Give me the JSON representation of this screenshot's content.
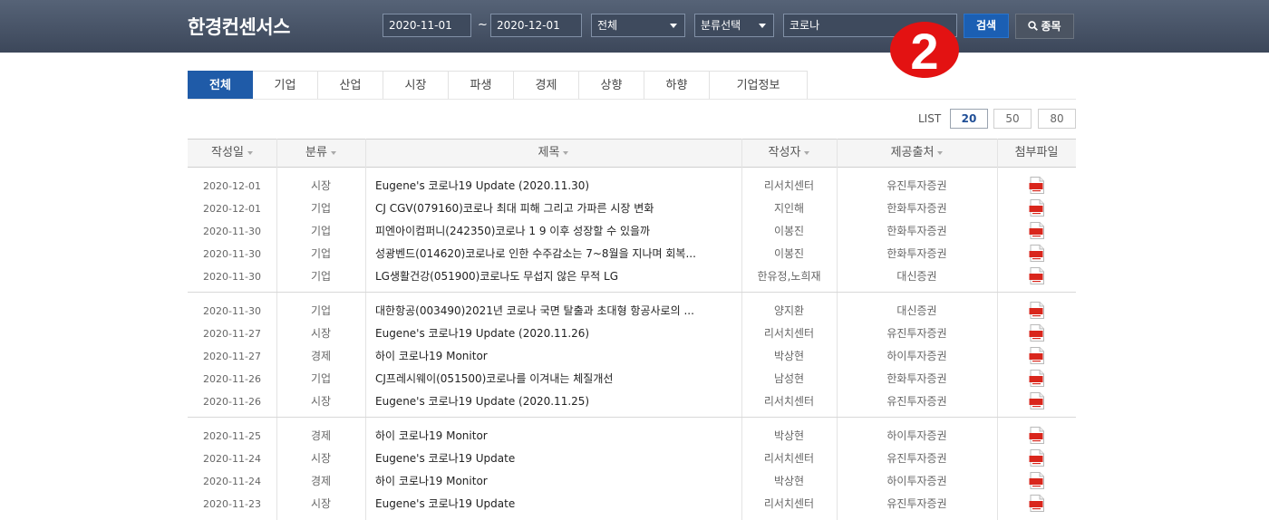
{
  "header": {
    "logo": "한경컨센서스",
    "date_from": "2020-11-01",
    "date_separator": "~",
    "date_to": "2020-12-01",
    "scope_select": "전체",
    "category_select": "분류선택",
    "search_value": "코로나",
    "search_button": "검색",
    "stock_button": "종목",
    "badge_number": "2"
  },
  "tabs": [
    "전체",
    "기업",
    "산업",
    "시장",
    "파생",
    "경제",
    "상향",
    "하향",
    "기업정보"
  ],
  "list": {
    "label": "LIST",
    "sizes": [
      "20",
      "50",
      "80"
    ],
    "selected": "20"
  },
  "table": {
    "columns": [
      "작성일",
      "분류",
      "제목",
      "작성자",
      "제공출처",
      "첨부파일"
    ],
    "rows": [
      {
        "date": "2020-12-01",
        "category": "시장",
        "title": "Eugene's 코로나19 Update (2020.11.30)",
        "author": "리서치센터",
        "source": "유진투자증권"
      },
      {
        "date": "2020-12-01",
        "category": "기업",
        "title": "CJ CGV(079160)코로나 최대 피해 그리고 가파른 시장 변화",
        "author": "지인해",
        "source": "한화투자증권"
      },
      {
        "date": "2020-11-30",
        "category": "기업",
        "title": "피엔아이컴퍼니(242350)코로나 1 9 이후 성장할 수 있을까",
        "author": "이봉진",
        "source": "한화투자증권"
      },
      {
        "date": "2020-11-30",
        "category": "기업",
        "title": "성광벤드(014620)코로나로 인한 수주감소는 7~8월을 지나며 회복...",
        "author": "이봉진",
        "source": "한화투자증권"
      },
      {
        "date": "2020-11-30",
        "category": "기업",
        "title": "LG생활건강(051900)코로나도 무섭지 않은 무적 LG",
        "author": "한유정,노희재",
        "source": "대신증권"
      },
      {
        "date": "2020-11-30",
        "category": "기업",
        "title": "대한항공(003490)2021년 코로나 국면 탈출과 초대형 항공사로의 ...",
        "author": "양지환",
        "source": "대신증권"
      },
      {
        "date": "2020-11-27",
        "category": "시장",
        "title": "Eugene's 코로나19 Update (2020.11.26)",
        "author": "리서치센터",
        "source": "유진투자증권"
      },
      {
        "date": "2020-11-27",
        "category": "경제",
        "title": "하이 코로나19 Monitor",
        "author": "박상현",
        "source": "하이투자증권"
      },
      {
        "date": "2020-11-26",
        "category": "기업",
        "title": "CJ프레시웨이(051500)코로나를 이겨내는 체질개선",
        "author": "남성현",
        "source": "한화투자증권"
      },
      {
        "date": "2020-11-26",
        "category": "시장",
        "title": "Eugene's 코로나19 Update (2020.11.25)",
        "author": "리서치센터",
        "source": "유진투자증권"
      },
      {
        "date": "2020-11-25",
        "category": "경제",
        "title": "하이 코로나19 Monitor",
        "author": "박상현",
        "source": "하이투자증권"
      },
      {
        "date": "2020-11-24",
        "category": "시장",
        "title": "Eugene's 코로나19 Update",
        "author": "리서치센터",
        "source": "유진투자증권"
      },
      {
        "date": "2020-11-24",
        "category": "경제",
        "title": "하이 코로나19 Monitor",
        "author": "박상현",
        "source": "하이투자증권"
      },
      {
        "date": "2020-11-23",
        "category": "시장",
        "title": "Eugene's 코로나19 Update",
        "author": "리서치센터",
        "source": "유진투자증권"
      }
    ]
  },
  "colors": {
    "topbar": "#4a5568",
    "active_tab": "#1f5ba8",
    "search_button": "#1b5fb3",
    "badge": "#e31212",
    "pdf_icon": "#d9261c"
  }
}
